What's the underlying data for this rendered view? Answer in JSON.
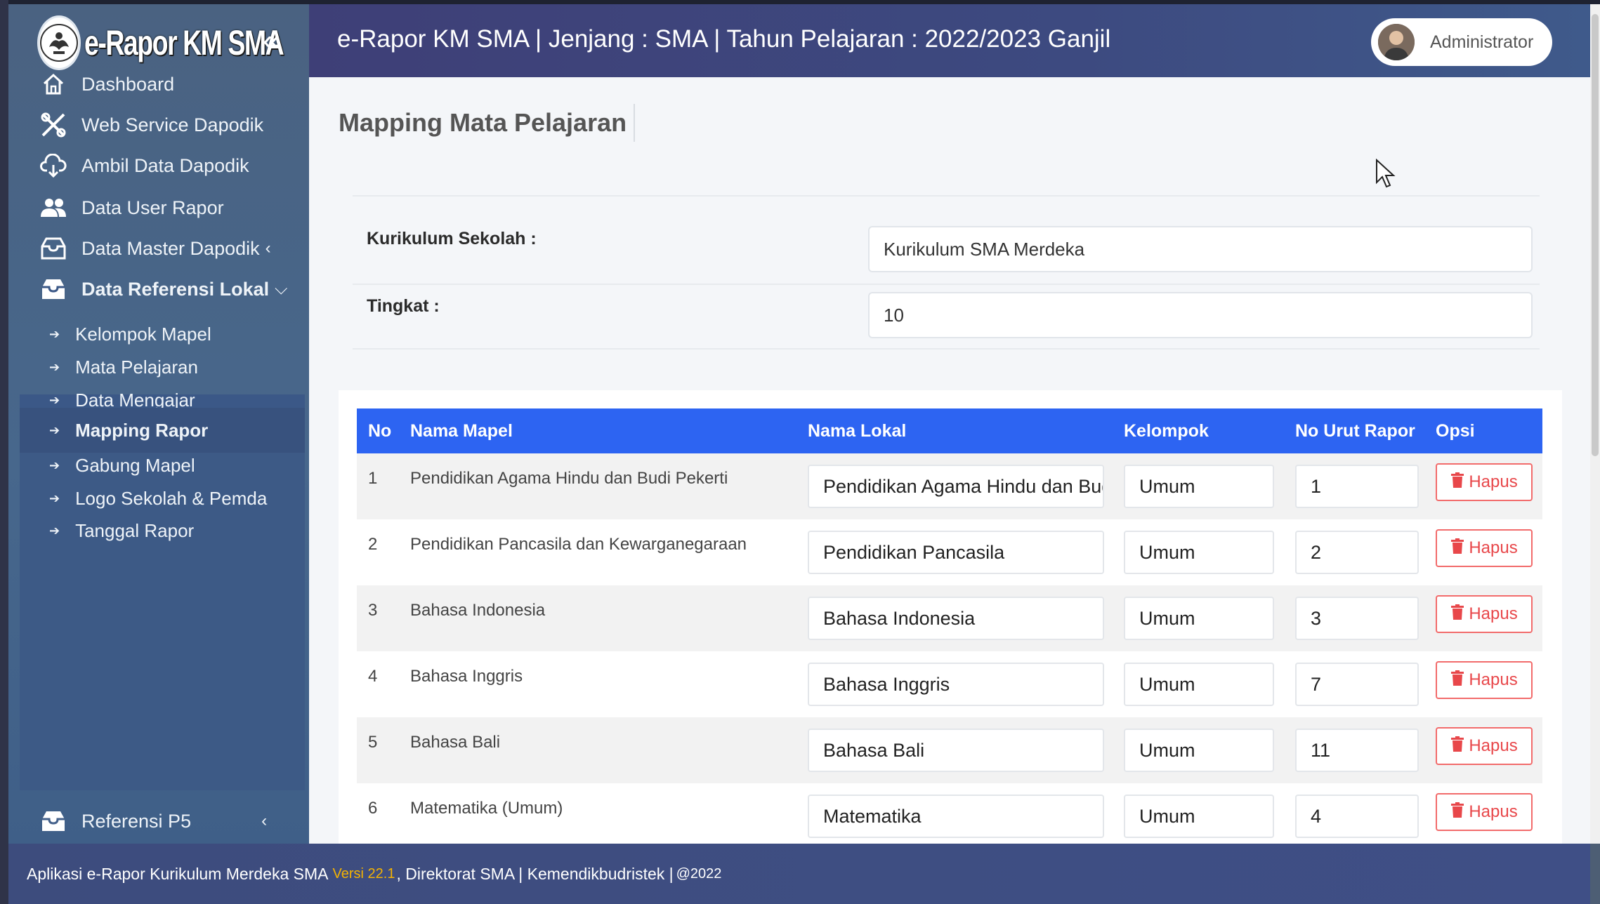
{
  "brand": {
    "name": "e-Rapor KM SMA"
  },
  "header": {
    "title": "e-Rapor KM SMA | Jenjang : SMA | Tahun Pelajaran : 2022/2023 Ganjil",
    "user": "Administrator"
  },
  "sidebar": {
    "items": [
      {
        "label": "Dashboard",
        "icon": "home-icon"
      },
      {
        "label": "Web Service Dapodik",
        "icon": "tools-icon"
      },
      {
        "label": "Ambil Data Dapodik",
        "icon": "cloud-download-icon"
      },
      {
        "label": "Data User Rapor",
        "icon": "users-icon"
      },
      {
        "label": "Data Master Dapodik",
        "icon": "inbox-icon",
        "caret": "‹"
      },
      {
        "label": "Data Referensi Lokal",
        "icon": "inbox-icon",
        "caret": "⌵"
      },
      {
        "label": "Referensi P5",
        "icon": "inbox-icon",
        "caret": "‹"
      }
    ],
    "submenu": [
      {
        "label": "Kelompok Mapel"
      },
      {
        "label": "Mata Pelajaran"
      },
      {
        "label": "Data Mengajar"
      },
      {
        "label": "Mapping Rapor",
        "active": true
      },
      {
        "label": "Gabung Mapel"
      },
      {
        "label": "Logo Sekolah & Pemda"
      },
      {
        "label": "Tanggal Rapor"
      }
    ]
  },
  "page": {
    "title": "Mapping Mata Pelajaran",
    "kurikulum_label": "Kurikulum Sekolah :",
    "kurikulum_value": "Kurikulum SMA Merdeka",
    "tingkat_label": "Tingkat :",
    "tingkat_value": "10"
  },
  "table": {
    "headers": [
      "No",
      "Nama Mapel",
      "Nama Lokal",
      "Kelompok",
      "No Urut Rapor",
      "Opsi"
    ],
    "delete_label": "Hapus",
    "rows": [
      {
        "no": "1",
        "mapel": "Pendidikan Agama Hindu dan Budi Pekerti",
        "lokal": "Pendidikan Agama Hindu dan Budi Pekerti",
        "kelompok": "Umum",
        "urut": "1"
      },
      {
        "no": "2",
        "mapel": "Pendidikan Pancasila dan Kewarganegaraan",
        "lokal": "Pendidikan Pancasila",
        "kelompok": "Umum",
        "urut": "2"
      },
      {
        "no": "3",
        "mapel": "Bahasa Indonesia",
        "lokal": "Bahasa Indonesia",
        "kelompok": "Umum",
        "urut": "3"
      },
      {
        "no": "4",
        "mapel": "Bahasa Inggris",
        "lokal": "Bahasa Inggris",
        "kelompok": "Umum",
        "urut": "7"
      },
      {
        "no": "5",
        "mapel": "Bahasa Bali",
        "lokal": "Bahasa Bali",
        "kelompok": "Umum",
        "urut": "11"
      },
      {
        "no": "6",
        "mapel": "Matematika (Umum)",
        "lokal": "Matematika",
        "kelompok": "Umum",
        "urut": "4"
      }
    ]
  },
  "footer": {
    "text1": "Aplikasi e-Rapor Kurikulum Merdeka SMA",
    "version": "Versi 22.1",
    "text2": ", Direktorat SMA | Kemendikbudristek |",
    "year": "@2022"
  },
  "colors": {
    "table_header": "#2d64f2",
    "danger": "#e8474a",
    "version": "#f5b301"
  }
}
